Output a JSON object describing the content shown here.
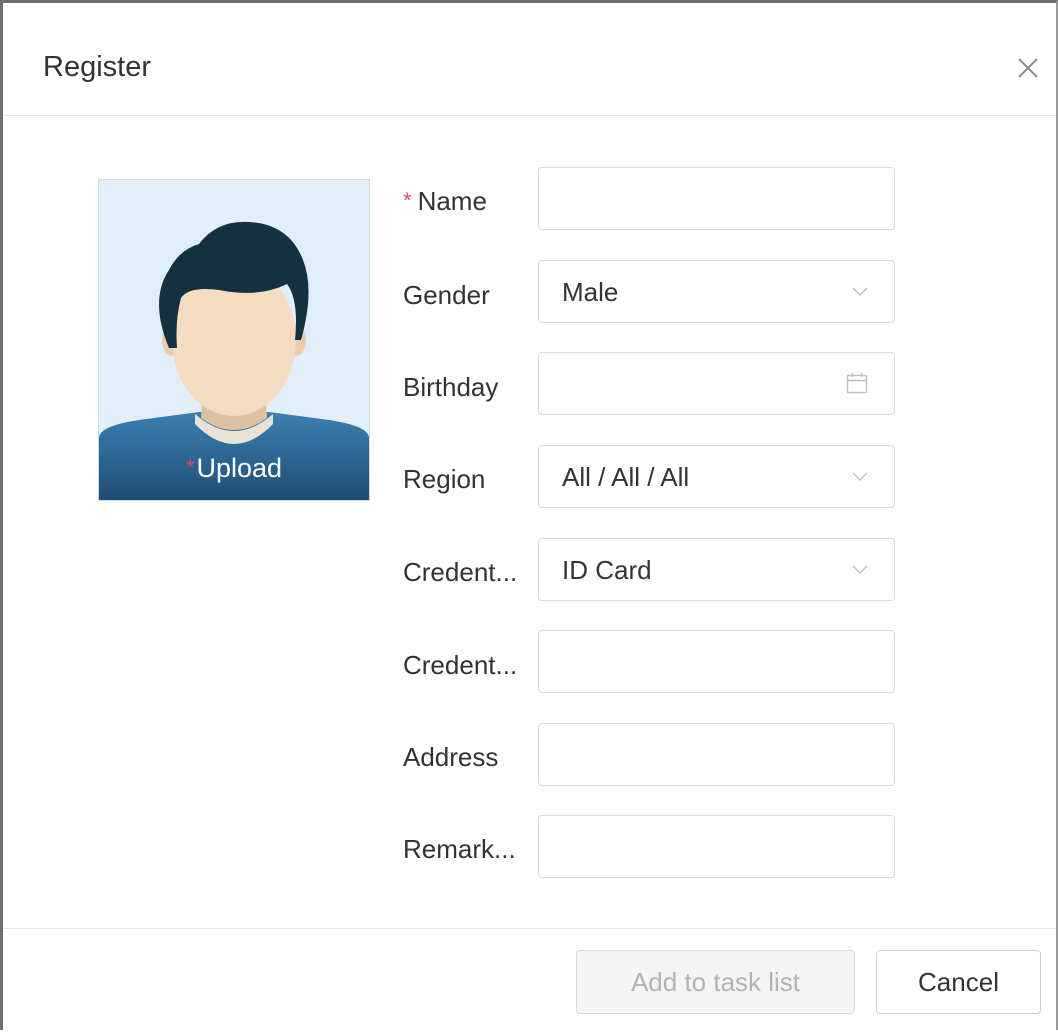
{
  "dialog": {
    "title": "Register",
    "close_icon": "close-icon"
  },
  "avatar": {
    "upload_required_mark": "*",
    "upload_label": "Upload",
    "colors": {
      "background": "#e2eff8",
      "hair": "#15303f",
      "skin": "#f3dcc2",
      "shirt": "#2f6c99"
    }
  },
  "form": {
    "required_mark": "*",
    "fields": [
      {
        "label": "Name",
        "type": "text",
        "value": "",
        "required": true
      },
      {
        "label": "Gender",
        "type": "select",
        "value": "Male",
        "icon": "chevron-down-icon"
      },
      {
        "label": "Birthday",
        "type": "date",
        "value": "",
        "icon": "calendar-icon"
      },
      {
        "label": "Region",
        "type": "select",
        "value": "All / All / All",
        "icon": "chevron-down-icon"
      },
      {
        "label": "Credent...",
        "type": "select",
        "value": "ID Card",
        "icon": "chevron-down-icon"
      },
      {
        "label": "Credent...",
        "type": "text",
        "value": ""
      },
      {
        "label": "Address",
        "type": "text",
        "value": ""
      },
      {
        "label": "Remark...",
        "type": "text",
        "value": ""
      }
    ]
  },
  "footer": {
    "add_label": "Add to task list",
    "cancel_label": "Cancel"
  },
  "colors": {
    "required": "#e8456b",
    "border": "#d9d9d9",
    "disabled_text": "#b3b3b3"
  }
}
